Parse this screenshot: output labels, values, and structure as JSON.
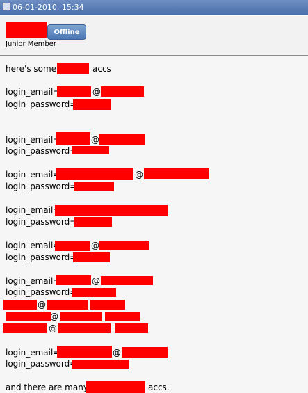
{
  "post": {
    "datetime": "06-01-2010, 15:34",
    "user_status": "Offline",
    "user_title": "Junior Member"
  },
  "body": {
    "intro_pre": "here's some",
    "intro_post": "accs",
    "email_label": "login_email=",
    "password_label": "login_password=",
    "at": "@",
    "outro_pre": "and there are many",
    "outro_post": "accs."
  }
}
